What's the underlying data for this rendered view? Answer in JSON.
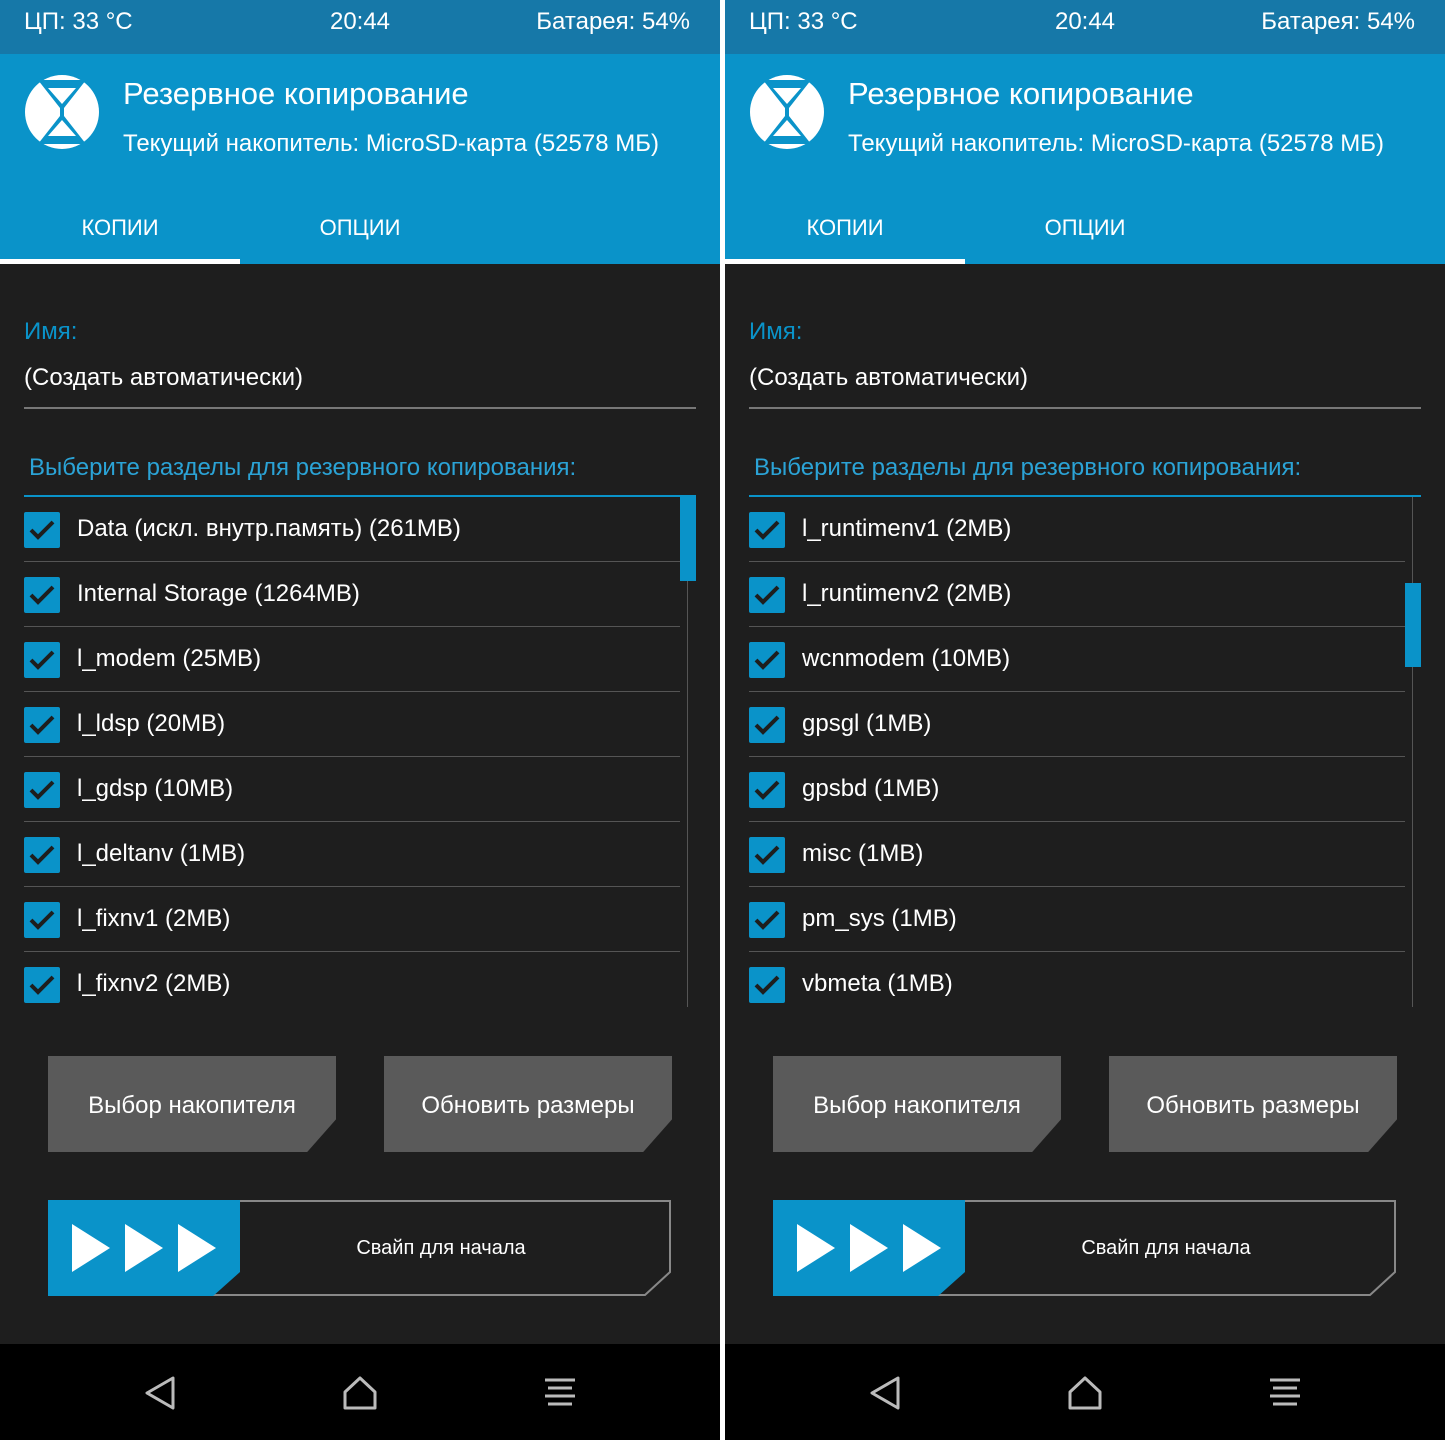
{
  "status": {
    "cpu": "ЦП: 33 °C",
    "time": "20:44",
    "battery": "Батарея: 54%"
  },
  "header": {
    "logo_icon": "twrp-logo-icon",
    "title": "Резервное копирование",
    "subtitle": "Текущий накопитель: MicroSD-карта (52578 МБ)"
  },
  "tabs": [
    {
      "label": "копии"
    },
    {
      "label": "опции"
    }
  ],
  "name": {
    "label": "Имя:",
    "value": "(Создать автоматически)"
  },
  "partitions_label": "Выберите разделы для резервного копирования:",
  "panels": [
    {
      "items": [
        {
          "label": "Data (искл. внутр.память) (261MB)",
          "checked": true
        },
        {
          "label": "Internal Storage (1264MB)",
          "checked": true
        },
        {
          "label": "l_modem (25MB)",
          "checked": true
        },
        {
          "label": "l_ldsp (20MB)",
          "checked": true
        },
        {
          "label": "l_gdsp (10MB)",
          "checked": true
        },
        {
          "label": "l_deltanv (1MB)",
          "checked": true
        },
        {
          "label": "l_fixnv1 (2MB)",
          "checked": true
        },
        {
          "label": "l_fixnv2 (2MB)",
          "checked": true
        }
      ]
    },
    {
      "items": [
        {
          "label": "l_runtimenv1 (2MB)",
          "checked": true
        },
        {
          "label": "l_runtimenv2 (2MB)",
          "checked": true
        },
        {
          "label": "wcnmodem (10MB)",
          "checked": true
        },
        {
          "label": "gpsgl (1MB)",
          "checked": true
        },
        {
          "label": "gpsbd (1MB)",
          "checked": true
        },
        {
          "label": "misc (1MB)",
          "checked": true
        },
        {
          "label": "pm_sys (1MB)",
          "checked": true
        },
        {
          "label": "vbmeta (1MB)",
          "checked": true
        }
      ]
    }
  ],
  "buttons": {
    "select_storage": "Выбор накопителя",
    "refresh_sizes": "Обновить размеры"
  },
  "swipe": {
    "label": "Свайп для начала"
  },
  "navbar": {
    "back_icon": "back-icon",
    "home_icon": "home-icon",
    "menu_icon": "menu-icon"
  },
  "colors": {
    "accent": "#0a93c9",
    "statusbar": "#1678a8",
    "background": "#1e1e1e",
    "button": "#5a5a5a",
    "navbar": "#000000"
  }
}
